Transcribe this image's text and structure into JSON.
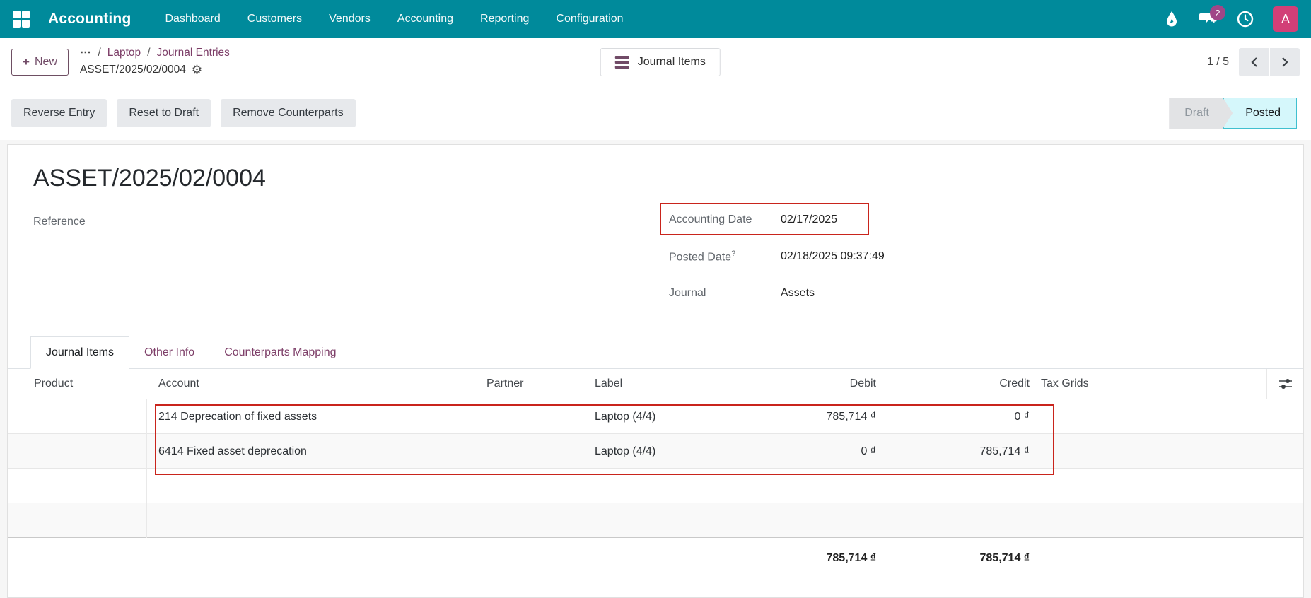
{
  "navbar": {
    "app_name": "Accounting",
    "menu": [
      {
        "label": "Dashboard"
      },
      {
        "label": "Customers"
      },
      {
        "label": "Vendors"
      },
      {
        "label": "Accounting"
      },
      {
        "label": "Reporting"
      },
      {
        "label": "Configuration"
      }
    ],
    "message_badge": "2",
    "avatar_initial": "A",
    "colors": {
      "bar": "#008a9b",
      "badge": "#a04687",
      "avatar": "#d23f77"
    }
  },
  "control_panel": {
    "new_label": "New",
    "new_plus": "+",
    "breadcrumb": {
      "ellipsis": "⋯",
      "sep1": "/",
      "link1": "Laptop",
      "sep2": "/",
      "link2": "Journal Entries",
      "current": "ASSET/2025/02/0004",
      "gear": "⚙"
    },
    "journal_items_button": "Journal Items",
    "pager": {
      "text": "1 / 5",
      "prev": "‹",
      "next": "›"
    }
  },
  "actions": [
    {
      "label": "Reverse Entry"
    },
    {
      "label": "Reset to Draft"
    },
    {
      "label": "Remove Counterparts"
    }
  ],
  "status": {
    "draft": "Draft",
    "posted": "Posted",
    "posted_colors": {
      "bg": "#d5f7fb",
      "border": "#3fc0cf"
    }
  },
  "form": {
    "title": "ASSET/2025/02/0004",
    "reference_label": "Reference",
    "accounting_date": {
      "label": "Accounting Date",
      "value": "02/17/2025"
    },
    "posted_date": {
      "label": "Posted Date",
      "help": "?",
      "value": "02/18/2025 09:37:49"
    },
    "journal": {
      "label": "Journal",
      "value": "Assets"
    }
  },
  "tabs": [
    {
      "label": "Journal Items",
      "active": true
    },
    {
      "label": "Other Info",
      "active": false
    },
    {
      "label": "Counterparts Mapping",
      "active": false
    }
  ],
  "table": {
    "columns": [
      "Product",
      "Account",
      "Partner",
      "Label",
      "Debit",
      "Credit",
      "Tax Grids"
    ],
    "rows": [
      {
        "product": "",
        "account": "214 Deprecation of fixed assets",
        "partner": "",
        "label": "Laptop (4/4)",
        "debit": "785,714 ₫",
        "credit": "0 ₫",
        "tax_grids": ""
      },
      {
        "product": "",
        "account": "6414 Fixed asset deprecation",
        "partner": "",
        "label": "Laptop (4/4)",
        "debit": "0 ₫",
        "credit": "785,714 ₫",
        "tax_grids": ""
      }
    ],
    "totals": {
      "debit": "785,714 ₫",
      "credit": "785,714 ₫"
    }
  },
  "annotations": {
    "highlight_color": "#c9241c"
  }
}
